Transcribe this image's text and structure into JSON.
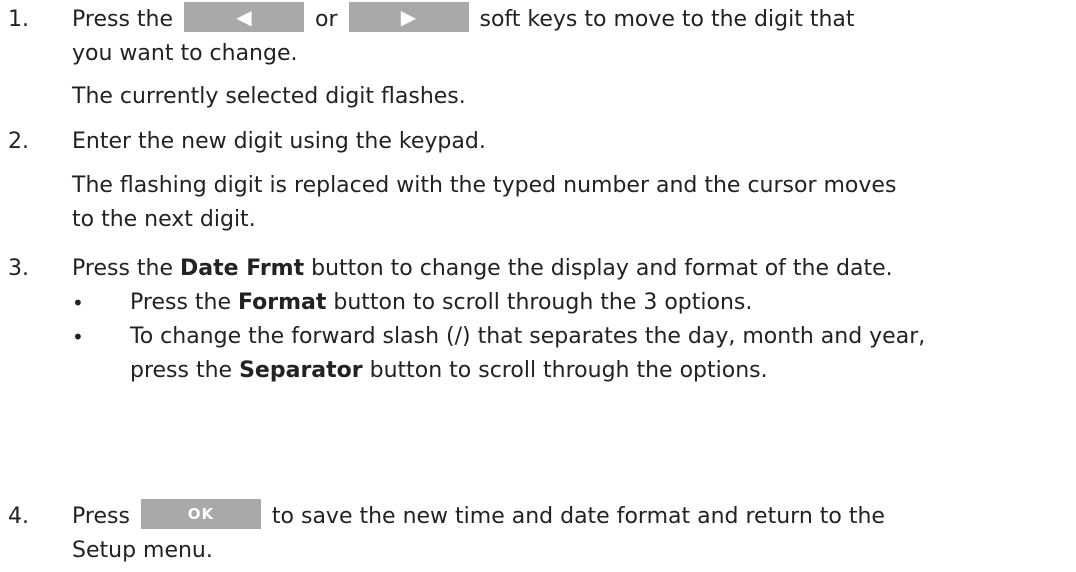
{
  "steps": [
    {
      "number": "1.",
      "line1_before": "Press the ",
      "left_key_icon": "left-triangle",
      "line1_mid": " or ",
      "right_key_icon": "right-triangle",
      "line1_after": " soft keys to move to the digit that",
      "line2": "you want to change.",
      "note": "The currently selected digit flashes."
    },
    {
      "number": "2.",
      "text": "Enter the new digit using the keypad.",
      "note_line1": "The flashing digit is replaced with the typed number and the cursor moves",
      "note_line2": "to the next digit."
    },
    {
      "number": "3.",
      "before": "Press the ",
      "bold": "Date Frmt",
      "after": " button to change the display and format of the date.",
      "bullets": [
        {
          "before": "Press the ",
          "bold": "Format",
          "after": " button to scroll through the 3 options."
        },
        {
          "line1": "To change the forward slash (/) that separates the day, month and year,",
          "before": "press the ",
          "bold": "Separator",
          "after": " button to scroll through the options."
        }
      ]
    },
    {
      "number": "4.",
      "before": "Press ",
      "key_label": "OK",
      "after": " to save the new time and date format and return to the",
      "line2": "Setup menu."
    }
  ],
  "colors": {
    "text": "#222222",
    "softkey_bg": "#a9a9a9",
    "softkey_glyph": "#ffffff"
  }
}
